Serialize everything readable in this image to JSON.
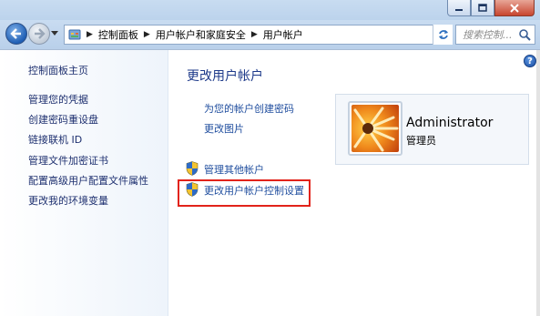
{
  "window": {
    "min_glyph": "minimize",
    "max_glyph": "maximize",
    "close_glyph": "close"
  },
  "nav": {
    "breadcrumb": [
      "控制面板",
      "用户帐户和家庭安全",
      "用户帐户"
    ],
    "search_placeholder": "搜索控制..."
  },
  "sidebar": {
    "items": [
      {
        "label": "控制面板主页"
      },
      {
        "label": "管理您的凭据"
      },
      {
        "label": "创建密码重设盘"
      },
      {
        "label": "链接联机 ID"
      },
      {
        "label": "管理文件加密证书"
      },
      {
        "label": "配置高级用户配置文件属性"
      },
      {
        "label": "更改我的环境变量"
      }
    ]
  },
  "main": {
    "heading": "更改用户帐户",
    "links": [
      {
        "label": "为您的帐户创建密码"
      },
      {
        "label": "更改图片"
      }
    ],
    "admin_links": [
      {
        "label": "管理其他帐户",
        "icon": "uac-shield-icon"
      },
      {
        "label": "更改用户帐户控制设置",
        "icon": "uac-shield-icon"
      }
    ]
  },
  "user": {
    "name": "Administrator",
    "role": "管理员"
  },
  "colors": {
    "link": "#1f4d9e",
    "highlight_box": "#e2231a",
    "chrome": "#c9dcf1"
  }
}
